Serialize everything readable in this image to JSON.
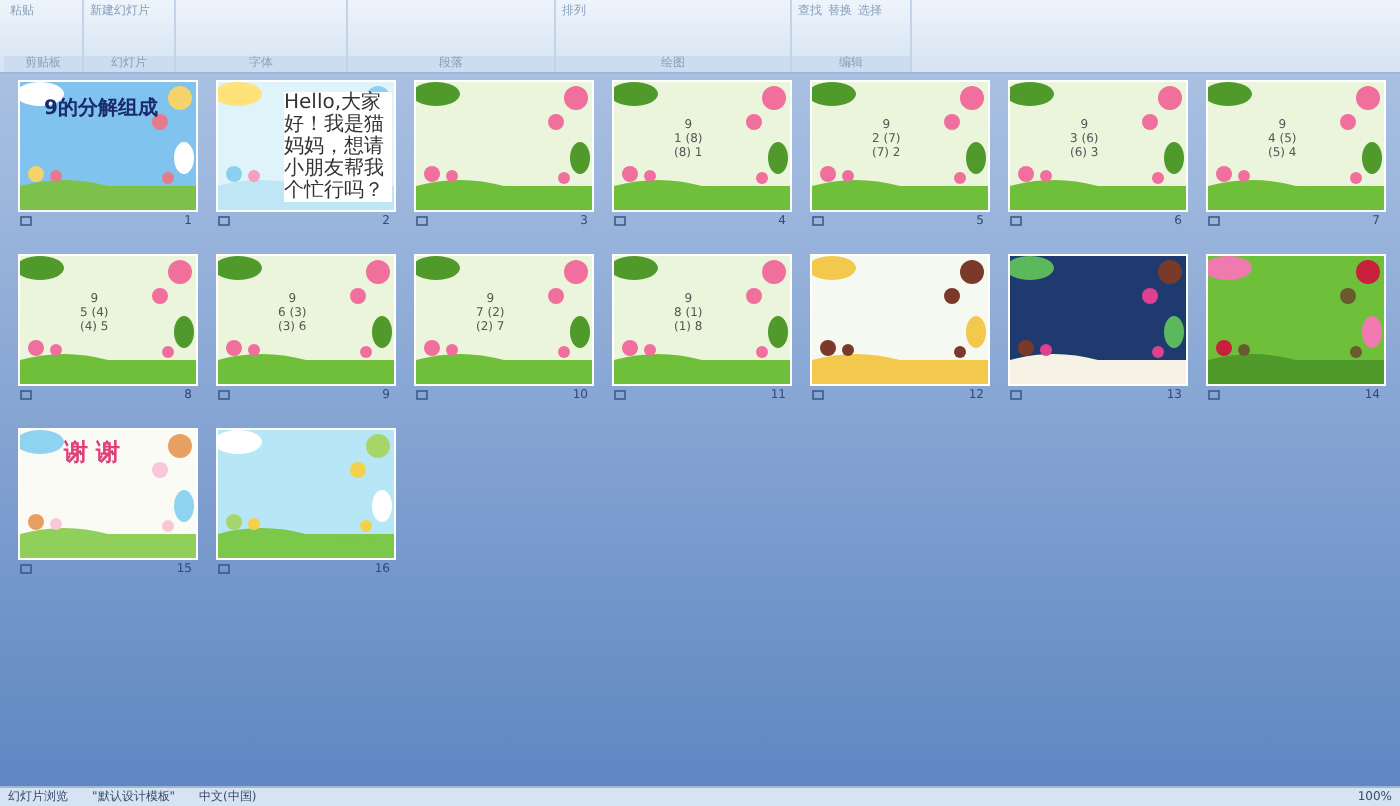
{
  "ribbon": {
    "groups": [
      {
        "label": "剪贴板",
        "buttons": [
          "粘贴"
        ]
      },
      {
        "label": "幻灯片",
        "buttons": [
          "新建幻灯片"
        ]
      },
      {
        "label": "字体"
      },
      {
        "label": "段落"
      },
      {
        "label": "绘图",
        "buttons": [
          "排列"
        ]
      },
      {
        "label": "编辑",
        "buttons": [
          "查找",
          "替换",
          "选择"
        ]
      }
    ]
  },
  "slides": [
    {
      "number": "1",
      "kind": "title",
      "lines": [
        "9的分解组成"
      ]
    },
    {
      "number": "2",
      "kind": "intro",
      "lines": [
        "Hello,大家好！我是猫妈妈，想请小朋友帮我个忙行吗？"
      ]
    },
    {
      "number": "3",
      "kind": "garden"
    },
    {
      "number": "4",
      "kind": "garden",
      "lines": [
        "9",
        "1 (8)",
        "(8) 1"
      ]
    },
    {
      "number": "5",
      "kind": "garden",
      "lines": [
        "9",
        "2 (7)",
        "(7) 2"
      ]
    },
    {
      "number": "6",
      "kind": "garden",
      "lines": [
        "9",
        "3 (6)",
        "(6) 3"
      ]
    },
    {
      "number": "7",
      "kind": "garden",
      "lines": [
        "9",
        "4 (5)",
        "(5) 4"
      ]
    },
    {
      "number": "8",
      "kind": "garden",
      "lines": [
        "9",
        "5 (4)",
        "(4) 5"
      ]
    },
    {
      "number": "9",
      "kind": "garden",
      "lines": [
        "9",
        "6 (3)",
        "(3) 6"
      ]
    },
    {
      "number": "10",
      "kind": "garden",
      "lines": [
        "9",
        "7 (2)",
        "(2) 7"
      ]
    },
    {
      "number": "11",
      "kind": "garden",
      "lines": [
        "9",
        "8 (1)",
        "(1) 8"
      ]
    },
    {
      "number": "12",
      "kind": "family"
    },
    {
      "number": "13",
      "kind": "night"
    },
    {
      "number": "14",
      "kind": "green"
    },
    {
      "number": "15",
      "kind": "thanks",
      "lines": [
        "谢 谢"
      ]
    },
    {
      "number": "16",
      "kind": "end"
    }
  ],
  "status_bar": {
    "left": [
      "幻灯片浏览",
      "\"默认设计模板\"",
      "中文(中国)"
    ],
    "zoom": "100%"
  }
}
